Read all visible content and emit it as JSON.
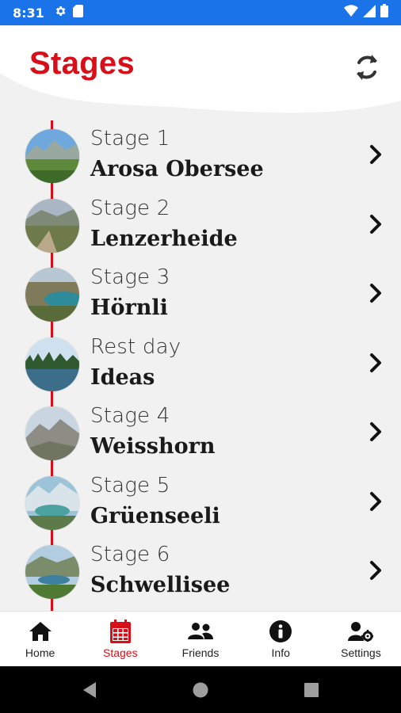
{
  "status_bar": {
    "time": "8:31",
    "icons": [
      "gear-icon",
      "sd-card-icon",
      "wifi-icon",
      "signal-icon",
      "battery-icon"
    ]
  },
  "header": {
    "title": "Stages",
    "refresh_icon": "refresh-icon"
  },
  "colors": {
    "accent": "#d80f18",
    "status_bar": "#1a73e8",
    "background": "#f1f1f1"
  },
  "stages": [
    {
      "subtitle": "Stage 1",
      "name": "Arosa Obersee",
      "thumb": "lake-meadow-photo"
    },
    {
      "subtitle": "Stage 2",
      "name": "Lenzerheide",
      "thumb": "mountain-trail-photo"
    },
    {
      "subtitle": "Stage 3",
      "name": "Hörnli",
      "thumb": "alpine-lake-photo"
    },
    {
      "subtitle": "Rest day",
      "name": "Ideas",
      "thumb": "lake-jump-photo"
    },
    {
      "subtitle": "Stage 4",
      "name": "Weisshorn",
      "thumb": "rocky-summit-photo"
    },
    {
      "subtitle": "Stage 5",
      "name": "Grüenseeli",
      "thumb": "glacier-lake-photo"
    },
    {
      "subtitle": "Stage 6",
      "name": "Schwellisee",
      "thumb": "valley-lake-photo"
    }
  ],
  "bottom_nav": {
    "items": [
      {
        "label": "Home",
        "icon": "home-icon"
      },
      {
        "label": "Stages",
        "icon": "calendar-icon",
        "active": true
      },
      {
        "label": "Friends",
        "icon": "friends-icon"
      },
      {
        "label": "Info",
        "icon": "info-icon"
      },
      {
        "label": "Settings",
        "icon": "user-settings-icon"
      }
    ]
  },
  "system_nav": [
    "back-icon",
    "home-circle-icon",
    "recents-icon"
  ]
}
